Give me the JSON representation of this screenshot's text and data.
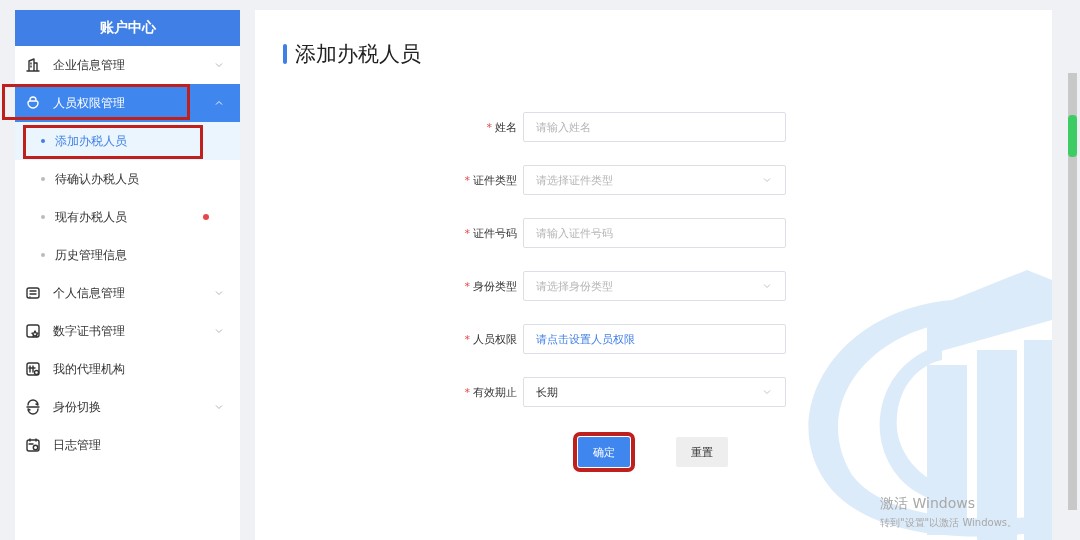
{
  "sidebar": {
    "title": "账户中心",
    "items": [
      {
        "kind": "group",
        "label": "企业信息管理",
        "expanded": false,
        "selected": false,
        "annotated": false
      },
      {
        "kind": "group",
        "label": "人员权限管理",
        "expanded": true,
        "selected": true,
        "annotated": true,
        "children": [
          {
            "label": "添加办税人员",
            "selected": true,
            "dot": false,
            "annotated": true
          },
          {
            "label": "待确认办税人员",
            "selected": false,
            "dot": false,
            "annotated": false
          },
          {
            "label": "现有办税人员",
            "selected": false,
            "dot": true,
            "annotated": false
          },
          {
            "label": "历史管理信息",
            "selected": false,
            "dot": false,
            "annotated": false
          }
        ]
      },
      {
        "kind": "group",
        "label": "个人信息管理",
        "expanded": false,
        "selected": false,
        "annotated": false
      },
      {
        "kind": "group",
        "label": "数字证书管理",
        "expanded": false,
        "selected": false,
        "annotated": false
      },
      {
        "kind": "link",
        "label": "我的代理机构",
        "selected": false,
        "annotated": false
      },
      {
        "kind": "group",
        "label": "身份切换",
        "expanded": false,
        "selected": false,
        "annotated": false
      },
      {
        "kind": "link",
        "label": "日志管理",
        "selected": false,
        "annotated": false
      }
    ]
  },
  "page": {
    "title": "添加办税人员",
    "fields": [
      {
        "kind": "input",
        "required_mark": "*",
        "label": "姓名",
        "placeholder": "请输入姓名"
      },
      {
        "kind": "select",
        "required_mark": "*",
        "label": "证件类型",
        "placeholder": "请选择证件类型"
      },
      {
        "kind": "input",
        "required_mark": "*",
        "label": "证件号码",
        "placeholder": "请输入证件号码"
      },
      {
        "kind": "select",
        "required_mark": "*",
        "label": "身份类型",
        "placeholder": "请选择身份类型"
      },
      {
        "kind": "link",
        "required_mark": "*",
        "label": "人员权限",
        "value": "请点击设置人员权限"
      },
      {
        "kind": "select",
        "required_mark": "*",
        "label": "有效期止",
        "value": "长期"
      }
    ],
    "buttons": [
      {
        "kind": "primary",
        "label": "确定",
        "annotated": true
      },
      {
        "kind": "secondary",
        "label": "重置",
        "annotated": false
      }
    ]
  },
  "os_notice": {
    "title": "激活 Windows",
    "subtitle": "转到\"设置\"以激活 Windows。"
  }
}
